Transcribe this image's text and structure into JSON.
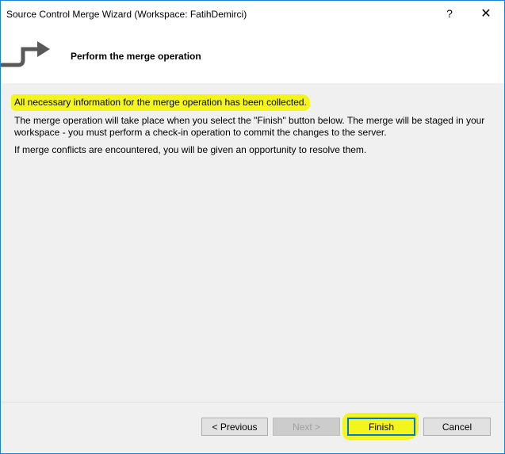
{
  "window": {
    "title": "Source Control Merge Wizard (Workspace: FatihDemirci)",
    "help_label": "?",
    "close_label": "✕"
  },
  "header": {
    "title": "Perform the merge operation",
    "icon": "merge-arrow-icon"
  },
  "content": {
    "summary": "All necessary information for the merge operation has been collected.",
    "paragraph1": "The merge operation will take place when you select the \"Finish\" button below. The merge will be staged in your workspace - you must perform a check-in operation to commit the changes to the server.",
    "paragraph2": "If merge conflicts are encountered, you will be given an opportunity to resolve them."
  },
  "buttons": {
    "previous": "< Previous",
    "next": "Next >",
    "finish": "Finish",
    "cancel": "Cancel"
  },
  "colors": {
    "highlight": "#f5f51e",
    "focus_border": "#0078d7",
    "window_border": "#1883d7"
  }
}
